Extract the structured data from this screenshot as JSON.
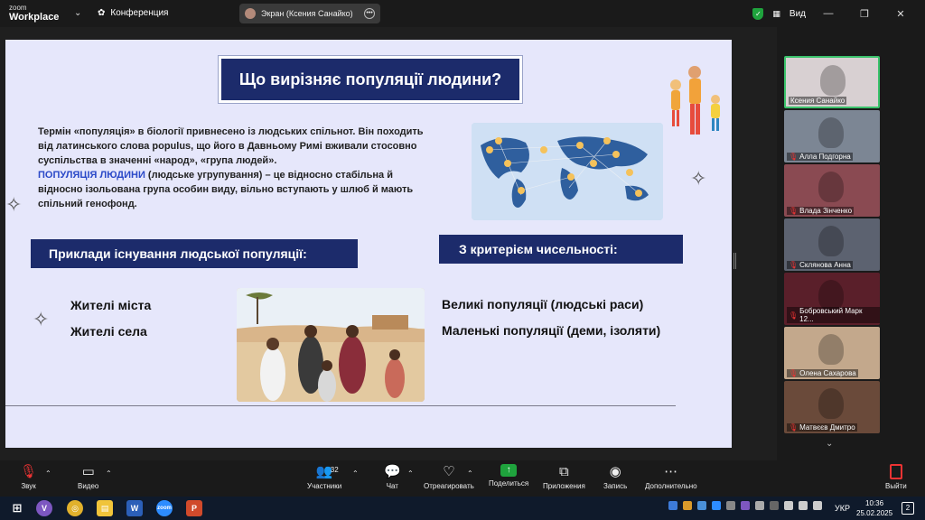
{
  "app": {
    "logo_line1": "zoom",
    "logo_line2": "Workplace",
    "conference_label": "Конференция",
    "share_label": "Экран (Ксения Санайко)",
    "view_label": "Вид"
  },
  "slide": {
    "title": "Що вирізняє популяції людини?",
    "paragraph_part1": "Термін «популяція» в біології привнесено із людських спільнот. Він походить від латинського слова populus, що його в Давньому Римі вживали стосовно суспільства в значенні «народ», «група людей».",
    "highlight": "ПОПУЛЯЦІЯ ЛЮДИНИ",
    "paragraph_part2": " (людське угрупування) – це відносно стабільна й відносно ізольована група особин виду, вільно вступають у шлюб й мають спільний генофонд.",
    "banner_left": "Приклади існування людської популяції:",
    "banner_right": "З критерієм чисельності:",
    "left_items": [
      "Жителі міста",
      "Жителі села"
    ],
    "right_items": [
      "Великі популяції (людські раси)",
      "Маленькі популяції (деми, ізоляти)"
    ]
  },
  "participants": [
    {
      "name": "Ксения Санайко",
      "active": true,
      "muted": false,
      "color": "#d8d0d2"
    },
    {
      "name": "Алла Подгорна",
      "active": false,
      "muted": true,
      "color": "#7c8694"
    },
    {
      "name": "Влада Зінченко",
      "active": false,
      "muted": true,
      "color": "#8a4a52"
    },
    {
      "name": "Склянова Анна",
      "active": false,
      "muted": true,
      "color": "#5c6270"
    },
    {
      "name": "Бобровський Марк 12...",
      "active": false,
      "muted": true,
      "color": "#5a1f2a"
    },
    {
      "name": "Олена Сахарова",
      "active": false,
      "muted": true,
      "color": "#c3a88c"
    },
    {
      "name": "Матвєєв Дмитро",
      "active": false,
      "muted": true,
      "color": "#6a4a3a"
    }
  ],
  "controls": {
    "audio": "Звук",
    "video": "Видео",
    "participants": "Участники",
    "participants_count": "32",
    "chat": "Чат",
    "react": "Отреагировать",
    "share": "Поделиться",
    "apps": "Приложения",
    "record": "Запись",
    "more": "Дополнительно",
    "leave": "Выйти"
  },
  "taskbar": {
    "language": "УКР",
    "time": "10:36",
    "date": "25.02.2025",
    "notifications": "2"
  },
  "colors": {
    "navy": "#1c2b6b",
    "slide_bg": "#e6e7fb",
    "highlight": "#2b49c8",
    "active_border": "#3ac26b"
  }
}
